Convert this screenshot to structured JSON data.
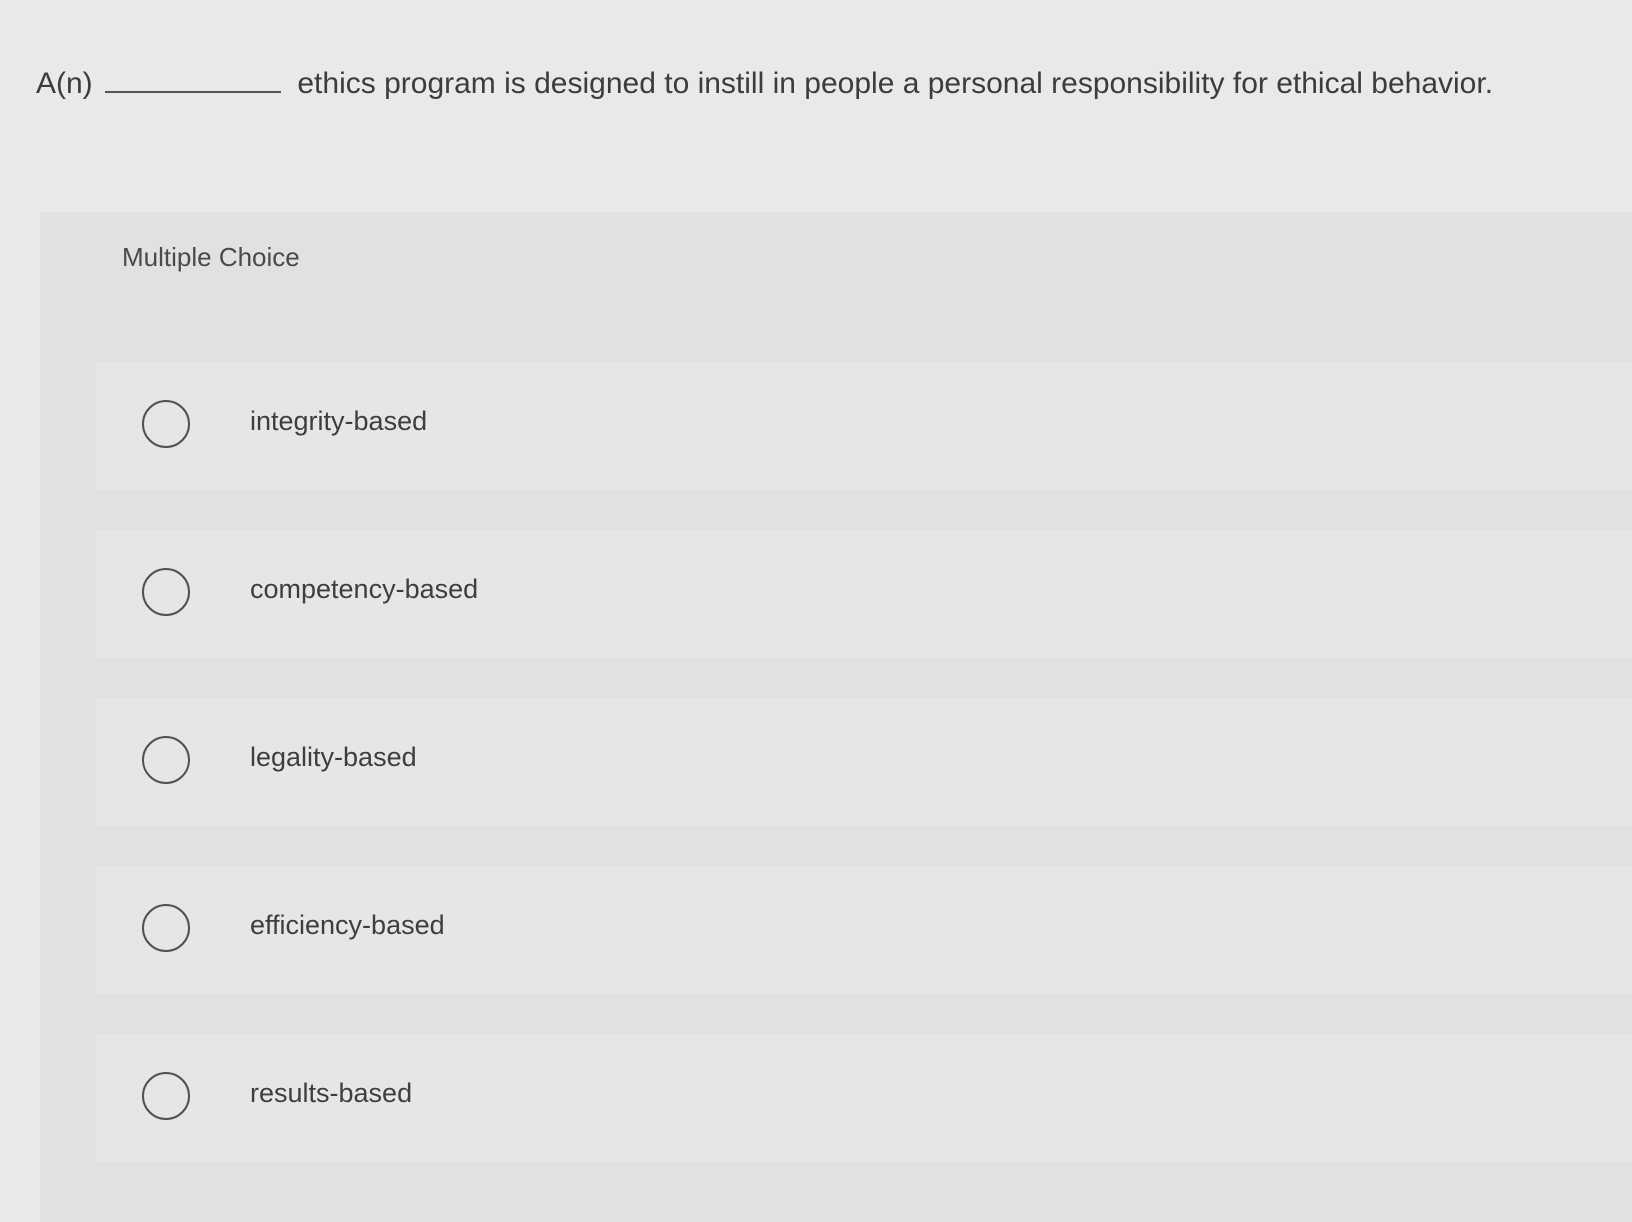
{
  "question": {
    "prefix": "A(n)",
    "suffix": "ethics program is designed to instill in people a personal responsibility for ethical behavior."
  },
  "choice": {
    "header": "Multiple Choice",
    "options": [
      {
        "label": "integrity-based"
      },
      {
        "label": "competency-based"
      },
      {
        "label": "legality-based"
      },
      {
        "label": "efficiency-based"
      },
      {
        "label": "results-based"
      }
    ]
  }
}
